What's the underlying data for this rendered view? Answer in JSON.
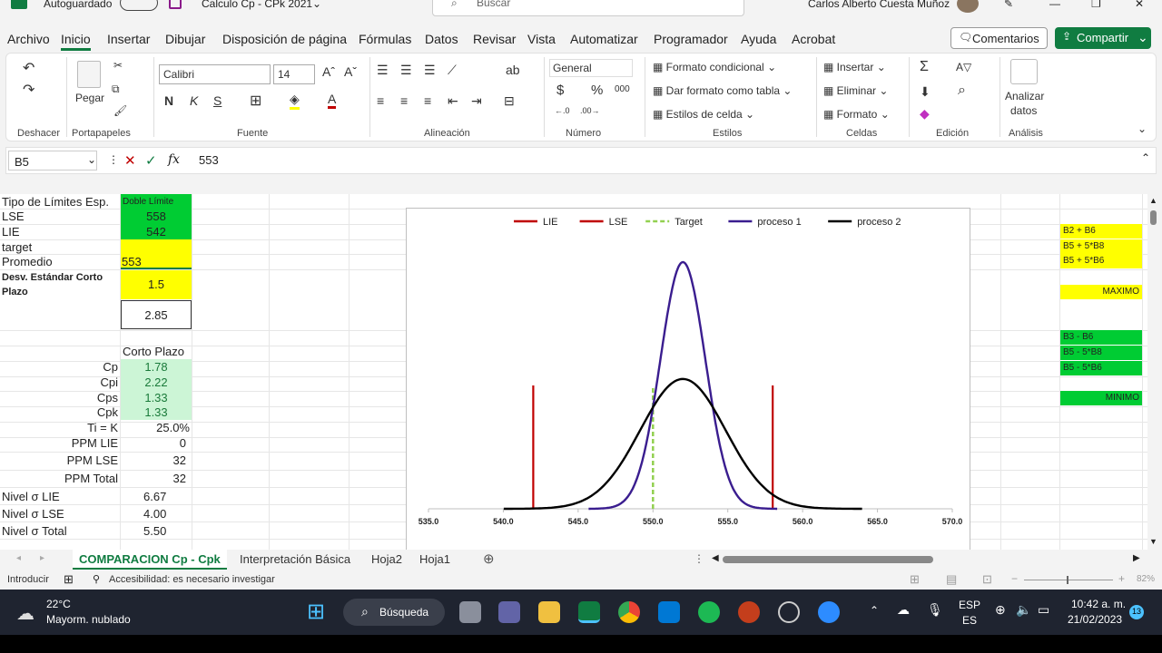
{
  "titlebar": {
    "autosave": "Autoguardado",
    "filename": "Calculo Cp - CPk 2021",
    "search": "Buscar",
    "user": "Carlos Alberto Cuesta Muñoz"
  },
  "menu": [
    "Archivo",
    "Inicio",
    "Insertar",
    "Dibujar",
    "Disposición de página",
    "Fórmulas",
    "Datos",
    "Revisar",
    "Vista",
    "Automatizar",
    "Programador",
    "Ayuda",
    "Acrobat"
  ],
  "comments_label": "Comentarios",
  "share_label": "Compartir",
  "ribbon": {
    "paste": "Pegar",
    "font_name": "Calibri",
    "font_size": "14",
    "number_format": "General",
    "cond_format": "Formato condicional",
    "table_format": "Dar formato como tabla",
    "cell_styles": "Estilos de celda",
    "insert": "Insertar",
    "delete": "Eliminar",
    "format": "Formato",
    "analyze_1": "Analizar",
    "analyze_2": "datos",
    "groups": {
      "undo": "Deshacer",
      "clipboard": "Portapapeles",
      "font": "Fuente",
      "alignment": "Alineación",
      "number": "Número",
      "styles": "Estilos",
      "cells": "Celdas",
      "editing": "Edición",
      "analysis": "Análisis"
    }
  },
  "formula": {
    "namebox": "B5",
    "content": "553"
  },
  "cells": {
    "a1": "Tipo de Límites Esp.",
    "b1": "Doble Límite",
    "a2": "LSE",
    "b2": "558",
    "a3": "LIE",
    "b3": "542",
    "a4": "target",
    "a5": "Promedio",
    "b5": "553",
    "a6": "Desv. Estándar Corto Plazo",
    "b6": "1.5",
    "b7": "2.85",
    "h1": "Corto Plazo",
    "labels": [
      "Cp",
      "Cpi",
      "Cps",
      "Cpk",
      "Ti = K",
      "PPM LIE",
      "PPM LSE",
      "PPM Total"
    ],
    "values": [
      "1.78",
      "2.22",
      "1.33",
      "1.33",
      "25.0%",
      "0",
      "32",
      "32"
    ],
    "sigma_labels": [
      "Nivel σ LIE",
      "Nivel σ LSE",
      "Nivel σ Total"
    ],
    "sigma_values": [
      "6.67",
      "4.00",
      "5.50"
    ]
  },
  "notes": {
    "y1": "B2 + B6",
    "y2": "B5 + 5*B8",
    "y3": "B5 + 5*B6",
    "ymax": "MAXIMO",
    "g1": "B3 - B6",
    "g2": "B5 - 5*B8",
    "g3": "B5 - 5*B6",
    "gmin": "MINIMO"
  },
  "chart_data": {
    "type": "line",
    "xlim": [
      535,
      570
    ],
    "xticks": [
      "535.0",
      "540.0",
      "545.0",
      "550.0",
      "555.0",
      "560.0",
      "565.0",
      "570.0"
    ],
    "legend_position": "top",
    "series": [
      {
        "name": "LIE",
        "color": "#c00000",
        "x": [
          542,
          542
        ],
        "y": [
          0,
          0.5
        ]
      },
      {
        "name": "LSE",
        "color": "#c00000",
        "x": [
          558,
          558
        ],
        "y": [
          0,
          0.5
        ]
      },
      {
        "name": "Target",
        "color": "#92d050",
        "dashed": true,
        "x": [
          550,
          550
        ],
        "y": [
          0,
          0.5
        ]
      },
      {
        "name": "proceso 1",
        "color": "#3a1d8f",
        "mean": 552,
        "sd": 1.5
      },
      {
        "name": "proceso 2",
        "color": "#000000",
        "mean": 552,
        "sd": 2.85
      }
    ]
  },
  "sheet_tabs": [
    "COMPARACION Cp - Cpk",
    "Interpretación Básica",
    "Hoja2",
    "Hoja1"
  ],
  "status": {
    "mode": "Introducir",
    "accessibility": "Accesibilidad: es necesario investigar",
    "zoom": "82%"
  },
  "taskbar": {
    "temp": "22°C",
    "weather": "Mayorm. nublado",
    "search": "Búsqueda",
    "lang1": "ESP",
    "lang2": "ES",
    "time": "10:42 a. m.",
    "date": "21/02/2023",
    "badge": "13"
  }
}
